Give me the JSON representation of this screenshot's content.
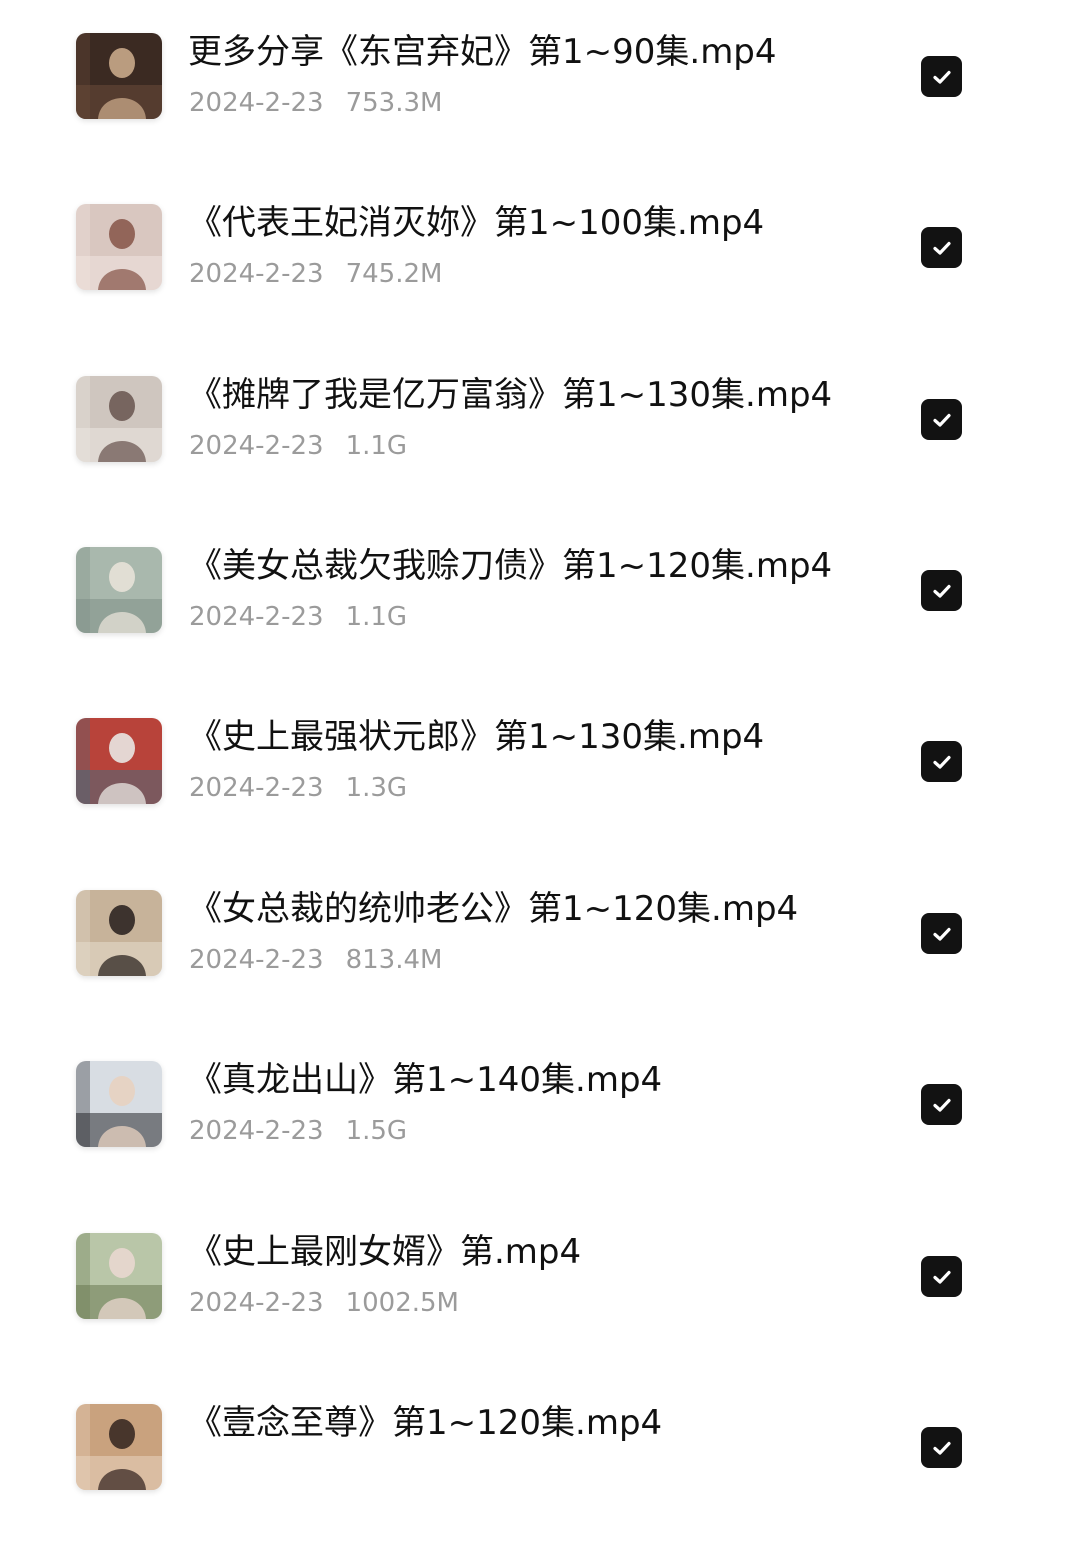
{
  "files": [
    {
      "name": "更多分享《东宫弃妃》第1~90集.mp4",
      "date": "2024-2-23",
      "size": "753.3M",
      "checked": true,
      "thumb_colors": [
        "#3b2a22",
        "#c9a88a",
        "#6b4a3a"
      ]
    },
    {
      "name": "《代表王妃消灭妳》第1~100集.mp4",
      "date": "2024-2-23",
      "size": "745.2M",
      "checked": true,
      "thumb_colors": [
        "#d9c7c0",
        "#8a5a4e",
        "#f0e4e0"
      ]
    },
    {
      "name": "《摊牌了我是亿万富翁》第1~130集.mp4",
      "date": "2024-2-23",
      "size": "1.1G",
      "checked": true,
      "thumb_colors": [
        "#cfc6bf",
        "#6d5a54",
        "#ece7e2"
      ]
    },
    {
      "name": "《美女总裁欠我赊刀债》第1~120集.mp4",
      "date": "2024-2-23",
      "size": "1.1G",
      "checked": true,
      "thumb_colors": [
        "#a9b8ad",
        "#e7e2d8",
        "#7f8f86"
      ]
    },
    {
      "name": "《史上最强状元郎》第1~130集.mp4",
      "date": "2024-2-23",
      "size": "1.3G",
      "checked": true,
      "thumb_colors": [
        "#b8433a",
        "#e9e7e3",
        "#4a6a7a"
      ]
    },
    {
      "name": "《女总裁的统帅老公》第1~120集.mp4",
      "date": "2024-2-23",
      "size": "813.4M",
      "checked": true,
      "thumb_colors": [
        "#c7b39a",
        "#2d2522",
        "#e6dccd"
      ]
    },
    {
      "name": "《真龙出山》第1~140集.mp4",
      "date": "2024-2-23",
      "size": "1.5G",
      "checked": true,
      "thumb_colors": [
        "#d8dde3",
        "#e8d2c0",
        "#2a2a30"
      ]
    },
    {
      "name": "《史上最刚女婿》第.mp4",
      "date": "2024-2-23",
      "size": "1002.5M",
      "checked": true,
      "thumb_colors": [
        "#b9c6a8",
        "#e9d7cf",
        "#6b7a52"
      ]
    },
    {
      "name": "《壹念至尊》第1~120集.mp4",
      "date": "",
      "size": "",
      "checked": true,
      "thumb_colors": [
        "#c9a27e",
        "#3a2a24",
        "#e8d4c0"
      ]
    }
  ],
  "icons": {
    "check": "check-icon",
    "thumbnail": "video-thumbnail"
  },
  "colors": {
    "title": "#111111",
    "meta": "#9b9b9b",
    "checkbox": "#121212"
  }
}
